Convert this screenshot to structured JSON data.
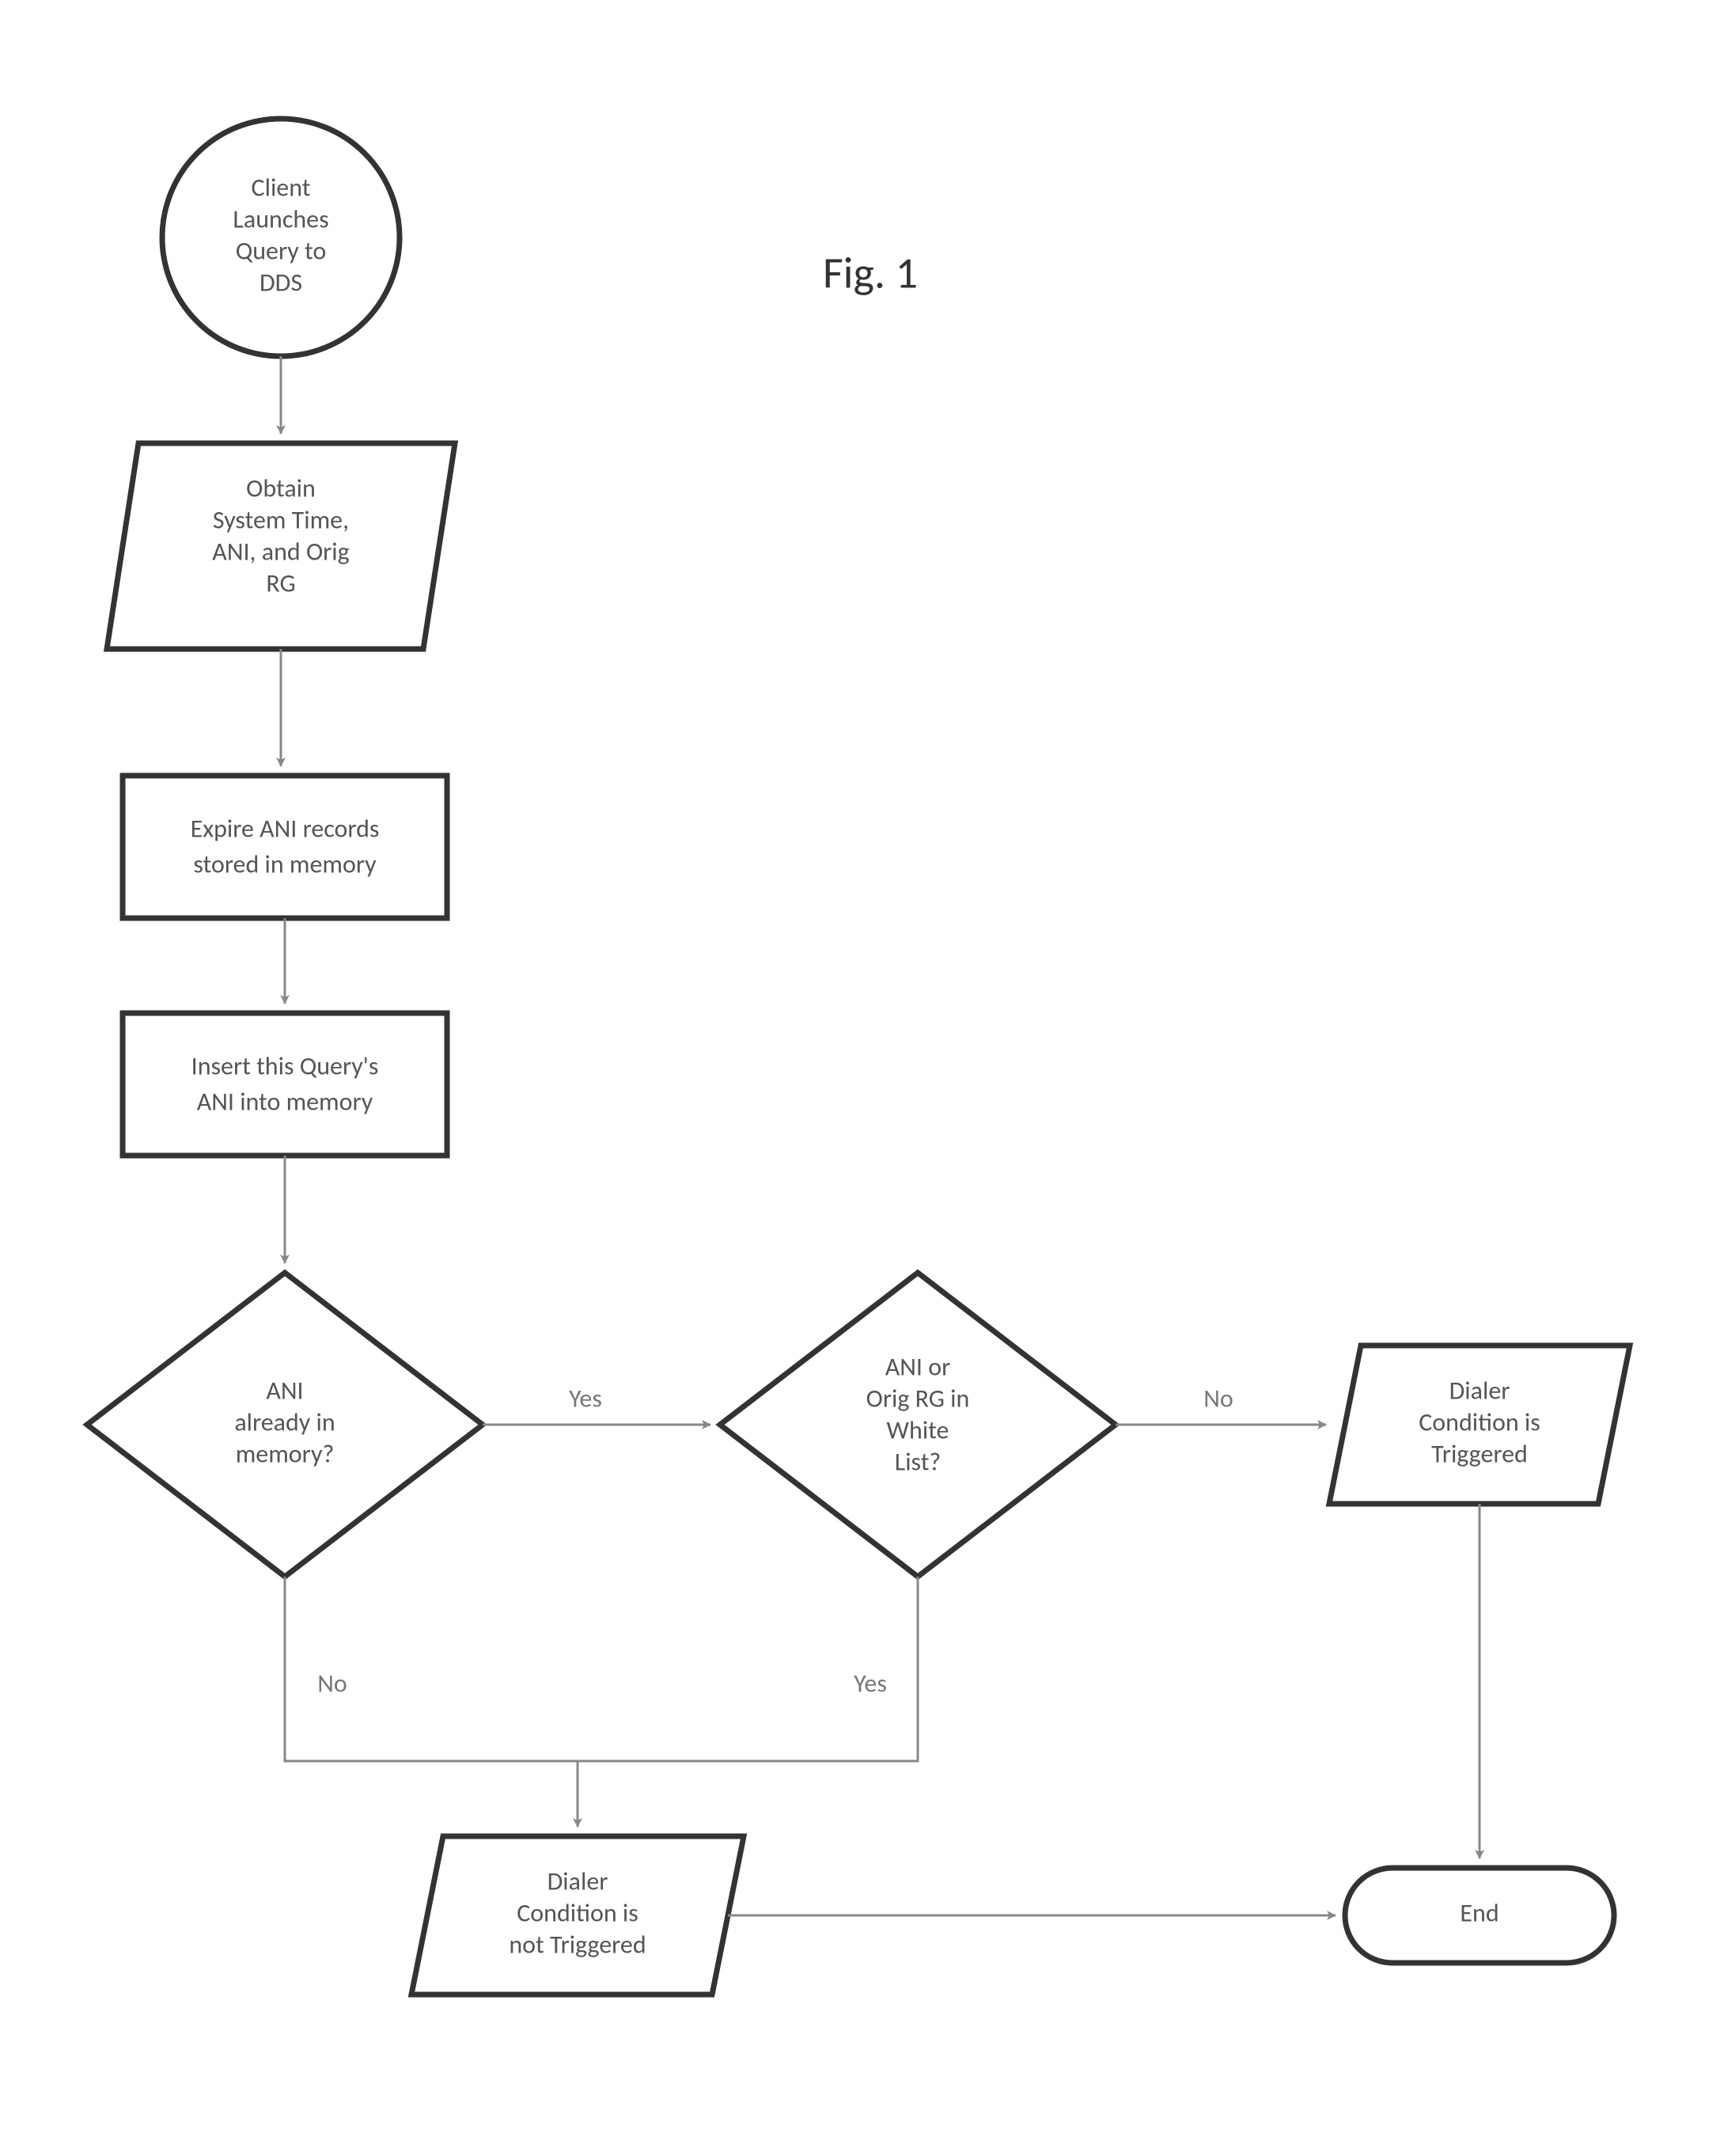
{
  "figure": {
    "title": "Fig. 1"
  },
  "nodes": {
    "start": {
      "l1": "Client",
      "l2": "Launches",
      "l3": "Query to",
      "l4": "DDS"
    },
    "obtain": {
      "l1": "Obtain",
      "l2": "System Time,",
      "l3": "ANI, and Orig",
      "l4": "RG"
    },
    "expire": {
      "l1": "Expire ANI records",
      "l2": "stored in memory"
    },
    "insert": {
      "l1": "Insert this Query's",
      "l2": "ANI into memory"
    },
    "dec_memory": {
      "l1": "ANI",
      "l2": "already in",
      "l3": "memory?"
    },
    "dec_whitelist": {
      "l1": "ANI or",
      "l2": "Orig RG in",
      "l3": "White",
      "l4": "List?"
    },
    "triggered": {
      "l1": "Dialer",
      "l2": "Condition is",
      "l3": "Triggered"
    },
    "not_triggered": {
      "l1": "Dialer",
      "l2": "Condition is",
      "l3": "not Triggered"
    },
    "end": {
      "l1": "End"
    }
  },
  "edges": {
    "yes": "Yes",
    "no": "No"
  }
}
